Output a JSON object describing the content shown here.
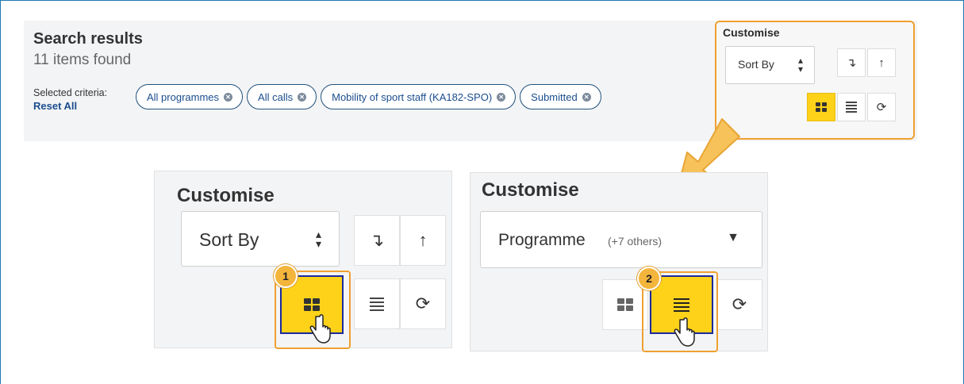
{
  "search": {
    "title": "Search results",
    "count": "11 items found",
    "criteria_label": "Selected criteria:",
    "reset_label": "Reset All",
    "chips": [
      "All programmes",
      "All calls",
      "Mobility of sport staff (KA182-SPO)",
      "Submitted"
    ]
  },
  "customise_mini": {
    "title": "Customise",
    "sort_label": "Sort By"
  },
  "customise_left": {
    "title": "Customise",
    "sort_label": "Sort By",
    "step": "1"
  },
  "customise_right": {
    "title": "Customise",
    "sort_value": "Programme",
    "sort_extra": "(+7 others)",
    "step": "2"
  },
  "colors": {
    "accent_yellow": "#ffd21a",
    "highlight_orange": "#f0a030",
    "frame_blue": "#1f78b4",
    "link_blue": "#1b4d8e"
  },
  "icons": [
    "cancel-icon",
    "sort-desc-icon",
    "sort-asc-icon",
    "grid-view-icon",
    "list-view-icon",
    "refresh-icon",
    "hand-cursor-icon",
    "arrow-icon"
  ]
}
